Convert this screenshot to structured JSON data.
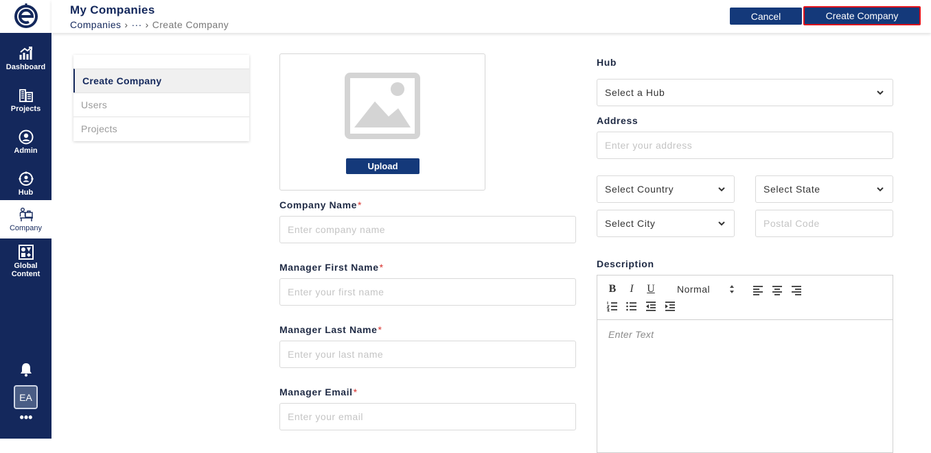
{
  "sidebar": {
    "logo": "e-logo",
    "items": [
      {
        "label": "Dashboard",
        "icon": "chart-growth-icon"
      },
      {
        "label": "Projects",
        "icon": "buildings-icon"
      },
      {
        "label": "Admin",
        "icon": "user-circle-icon"
      },
      {
        "label": "Hub",
        "icon": "hub-network-icon"
      },
      {
        "label": "Company",
        "icon": "company-desk-icon"
      },
      {
        "label": "Global",
        "label2": "Content",
        "icon": "content-grid-icon"
      }
    ],
    "active": "Company",
    "avatar_initials": "EA",
    "more_label": "•••"
  },
  "header": {
    "title": "My Companies",
    "breadcrumb": {
      "root": "Companies",
      "ellipsis": "···",
      "current": "Create Company"
    },
    "cancel_label": "Cancel",
    "create_label": "Create Company"
  },
  "tabs": [
    {
      "label": "Create Company",
      "active": true
    },
    {
      "label": "Users",
      "active": false
    },
    {
      "label": "Projects",
      "active": false
    }
  ],
  "upload": {
    "button_label": "Upload",
    "icon": "image-placeholder-icon"
  },
  "form": {
    "company_name": {
      "label": "Company Name",
      "required": "*",
      "placeholder": "Enter company name"
    },
    "first_name": {
      "label": "Manager First Name",
      "required": "*",
      "placeholder": "Enter your first name"
    },
    "last_name": {
      "label": "Manager Last Name",
      "required": "*",
      "placeholder": "Enter your last name"
    },
    "email": {
      "label": "Manager Email",
      "required": "*",
      "placeholder": "Enter your email"
    },
    "hub": {
      "label": "Hub",
      "value": "Select a Hub"
    },
    "address": {
      "label": "Address",
      "placeholder": "Enter your address"
    },
    "country": {
      "value": "Select Country"
    },
    "state": {
      "value": "Select State"
    },
    "city": {
      "value": "Select City"
    },
    "postal": {
      "placeholder": "Postal Code"
    },
    "description": {
      "label": "Description",
      "format_value": "Normal",
      "placeholder": "Enter Text"
    }
  },
  "colors": {
    "navy": "#14285c",
    "button": "#14397a",
    "required": "#d9302c",
    "highlight": "#e0101a"
  }
}
